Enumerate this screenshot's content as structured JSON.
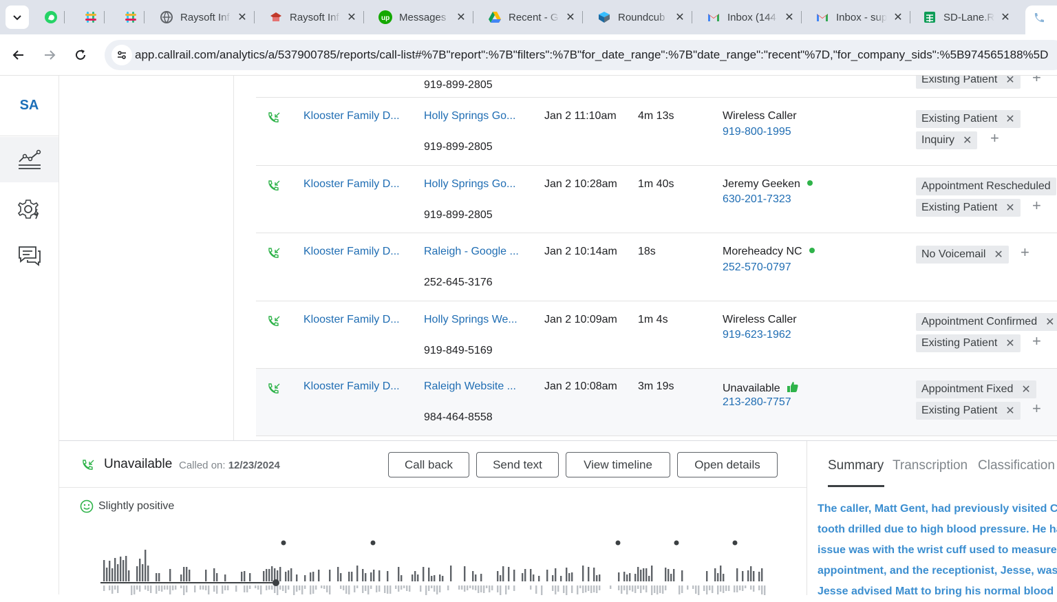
{
  "browser": {
    "tabs": [
      {
        "label": "",
        "icon": "whatsapp-icon",
        "color": "#25d366"
      },
      {
        "label": "",
        "icon": "slack-icon",
        "color": "#e01e5a"
      },
      {
        "label": "",
        "icon": "slack-icon",
        "color": "#e01e5a"
      },
      {
        "label": "Raysoft Inf",
        "icon": "globe-icon",
        "color": "#5f6368"
      },
      {
        "label": "Raysoft Inf",
        "icon": "school-icon",
        "color": "#c0392b"
      },
      {
        "label": "Messages",
        "icon": "upwork-icon",
        "color": "#14a800"
      },
      {
        "label": "Recent - G",
        "icon": "drive-icon",
        "color": "#1a73e8"
      },
      {
        "label": "Roundcub",
        "icon": "roundcube-icon",
        "color": "#37beff"
      },
      {
        "label": "Inbox (144",
        "icon": "gmail-icon",
        "color": "#ea4335"
      },
      {
        "label": "Inbox - sup",
        "icon": "gmail-icon",
        "color": "#ea4335"
      },
      {
        "label": "SD-Lane.R",
        "icon": "sheets-icon",
        "color": "#0f9d58"
      }
    ],
    "url": "app.callrail.com/analytics/a/537900785/reports/call-list#%7B\"report\":%7B\"filters\":%7B\"for_date_range\":%7B\"date_range\":\"recent\"%7D,\"for_company_sids\":%5B974565188%5D"
  },
  "nav": {
    "logo": "SA",
    "items": [
      "analytics-icon",
      "settings-icon",
      "messages-icon"
    ]
  },
  "calls": {
    "partial_top_number": "919-899-2805",
    "partial_top_tag": "Existing Patient",
    "rows": [
      {
        "company": "Klooster Family D...",
        "source": "Holly Springs Go...",
        "tracking": "919-899-2805",
        "datetime": "Jan 2 11:10am",
        "duration": "4m 13s",
        "caller": "Wireless Caller",
        "caller_phone": "919-800-1995",
        "tags": [
          "Existing Patient",
          "Inquiry"
        ]
      },
      {
        "company": "Klooster Family D...",
        "source": "Holly Springs Go...",
        "tracking": "919-899-2805",
        "datetime": "Jan 2 10:28am",
        "duration": "1m 40s",
        "caller": "Jeremy Geeken",
        "caller_phone": "630-201-7323",
        "tags": [
          "Appointment Rescheduled",
          "Existing Patient"
        ]
      },
      {
        "company": "Klooster Family D...",
        "source": "Raleigh - Google ...",
        "tracking": "252-645-3176",
        "datetime": "Jan 2 10:14am",
        "duration": "18s",
        "caller": "Moreheadcy NC",
        "caller_phone": "252-570-0797",
        "tags": [
          "No Voicemail"
        ]
      },
      {
        "company": "Klooster Family D...",
        "source": "Holly Springs We...",
        "tracking": "919-849-5169",
        "datetime": "Jan 2 10:09am",
        "duration": "1m 4s",
        "caller": "Wireless Caller",
        "caller_phone": "919-623-1962",
        "tags": [
          "Appointment Confirmed",
          "Existing Patient"
        ]
      },
      {
        "company": "Klooster Family D...",
        "source": "Raleigh Website ...",
        "tracking": "984-464-8558",
        "datetime": "Jan 2 10:08am",
        "duration": "3m 19s",
        "caller": "Unavailable",
        "caller_phone": "213-280-7757",
        "tags": [
          "Appointment Fixed",
          "Existing Patient"
        ]
      }
    ]
  },
  "detail": {
    "caller": "Unavailable",
    "called_label": "Called on:",
    "called_date": "12/23/2024",
    "buttons": {
      "call_back": "Call back",
      "send_text": "Send text",
      "view_timeline": "View timeline",
      "open_details": "Open details"
    },
    "sentiment": "Slightly positive",
    "tabs": [
      "Summary",
      "Transcription",
      "Classification"
    ],
    "summary_lines": [
      "The caller, Matt Gent, had previously visited Cli",
      "tooth drilled due to high blood pressure. He ha",
      "issue was with the wrist cuff used to measure h",
      "appointment, and the receptionist, Jesse, was",
      "Jesse advised Matt to bring his normal blood"
    ]
  },
  "colors": {
    "link": "#1f6db3",
    "green": "#2fb34a",
    "summary": "#3b8ed0"
  }
}
